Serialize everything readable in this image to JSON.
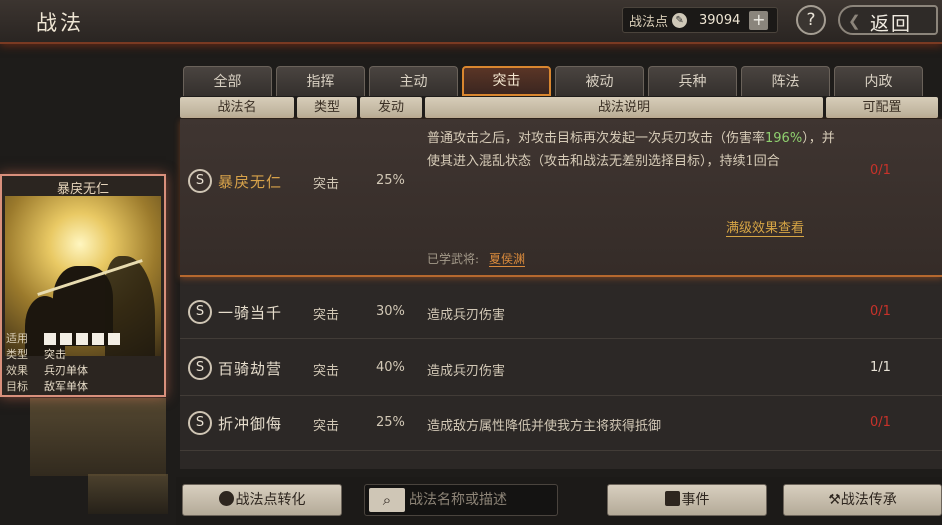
{
  "header": {
    "title": "战法",
    "points_label": "战法点",
    "points_value": "39094",
    "help_label": "?",
    "back_label": "返回"
  },
  "card": {
    "name": "暴戾无仁",
    "rows": [
      {
        "k": "适用",
        "v": ""
      },
      {
        "k": "类型",
        "v": "突击"
      },
      {
        "k": "效果",
        "v": "兵刃单体"
      },
      {
        "k": "目标",
        "v": "敌军单体"
      }
    ]
  },
  "tabs": [
    "全部",
    "指挥",
    "主动",
    "突击",
    "被动",
    "兵种",
    "阵法",
    "内政"
  ],
  "active_tab": "突击",
  "columns": [
    "战法名",
    "类型",
    "发动",
    "战法说明",
    "可配置"
  ],
  "rows": [
    {
      "grade": "S",
      "name": "暴戾无仁",
      "type": "突击",
      "rate": "25%",
      "desc_a": "普通攻击之后，对攻击目标再次发起一次兵刃攻击（伤害率",
      "desc_hl": "196%",
      "desc_b": "），并使其进入混乱状态（攻击和战法无差别选择目标），持续1回合",
      "config": "0/1",
      "max_level": "满级效果查看",
      "learned_label": "已学武将:",
      "learned_general": "夏侯渊"
    },
    {
      "grade": "S",
      "name": "一骑当千",
      "type": "突击",
      "rate": "30%",
      "desc": "造成兵刃伤害",
      "config": "0/1"
    },
    {
      "grade": "S",
      "name": "百骑劫营",
      "type": "突击",
      "rate": "40%",
      "desc": "造成兵刃伤害",
      "config": "1/1"
    },
    {
      "grade": "S",
      "name": "折冲御侮",
      "type": "突击",
      "rate": "25%",
      "desc": "造成敌方属性降低并使我方主将获得抵御",
      "config": "0/1"
    }
  ],
  "bottom": {
    "convert_label": "战法点转化",
    "search_placeholder": "战法名称或描述",
    "events_label": "事件",
    "inherit_label": "战法传承"
  },
  "colors": {
    "accent": "#d9862f",
    "config_red": "#c8322a",
    "highlight": "#8fd06f"
  }
}
